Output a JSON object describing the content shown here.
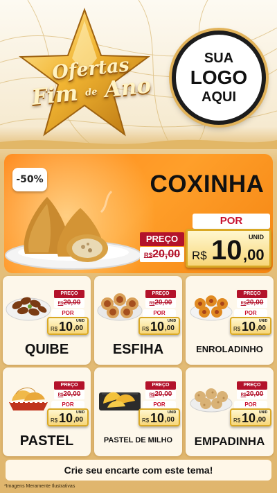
{
  "header": {
    "title_line1": "Ofertas",
    "title_line2_a": "Fim",
    "title_line2_de": "de",
    "title_line2_b": "Ano",
    "logo_line1": "SUA",
    "logo_line2": "LOGO",
    "logo_line3": "AQUI"
  },
  "hero": {
    "discount": "-50%",
    "name": "COXINHA",
    "preco_label": "PREÇO",
    "old_currency": "R$",
    "old_value": "20,00",
    "por_label": "POR",
    "unid_label": "UNID",
    "currency": "R$",
    "price_int": "10",
    "price_dec": ",00"
  },
  "products": [
    {
      "name": "QUIBE",
      "preco_label": "PREÇO",
      "old_currency": "R$",
      "old_value": "20,00",
      "por_label": "POR",
      "currency": "R$",
      "price_int": "10",
      "price_dec": ",00",
      "unid_label": "UNID"
    },
    {
      "name": "ESFIHA",
      "preco_label": "PREÇO",
      "old_currency": "R$",
      "old_value": "20,00",
      "por_label": "POR",
      "currency": "R$",
      "price_int": "10",
      "price_dec": ",00",
      "unid_label": "UNID"
    },
    {
      "name": "ENROLADINHO",
      "preco_label": "PREÇO",
      "old_currency": "R$",
      "old_value": "20,00",
      "por_label": "POR",
      "currency": "R$",
      "price_int": "10",
      "price_dec": ",00",
      "unid_label": "UNID"
    },
    {
      "name": "PASTEL",
      "preco_label": "PREÇO",
      "old_currency": "R$",
      "old_value": "20,00",
      "por_label": "POR",
      "currency": "R$",
      "price_int": "10",
      "price_dec": ",00",
      "unid_label": "UNID"
    },
    {
      "name": "PASTEL DE MILHO",
      "preco_label": "PREÇO",
      "old_currency": "R$",
      "old_value": "20,00",
      "por_label": "POR",
      "currency": "R$",
      "price_int": "10",
      "price_dec": ",00",
      "unid_label": "UNID"
    },
    {
      "name": "EMPADINHA",
      "preco_label": "PREÇO",
      "old_currency": "R$",
      "old_value": "20,00",
      "por_label": "POR",
      "currency": "R$",
      "price_int": "10",
      "price_dec": ",00",
      "unid_label": "UNID"
    }
  ],
  "cta": "Crie seu encarte com este tema!",
  "disclaimer": "*Imagens Meramente Ilustrativas",
  "colors": {
    "accent_orange": "#ff8a1d",
    "price_red": "#b3122a",
    "gold": "#d9a825",
    "background_gold": "#e0b66d"
  }
}
